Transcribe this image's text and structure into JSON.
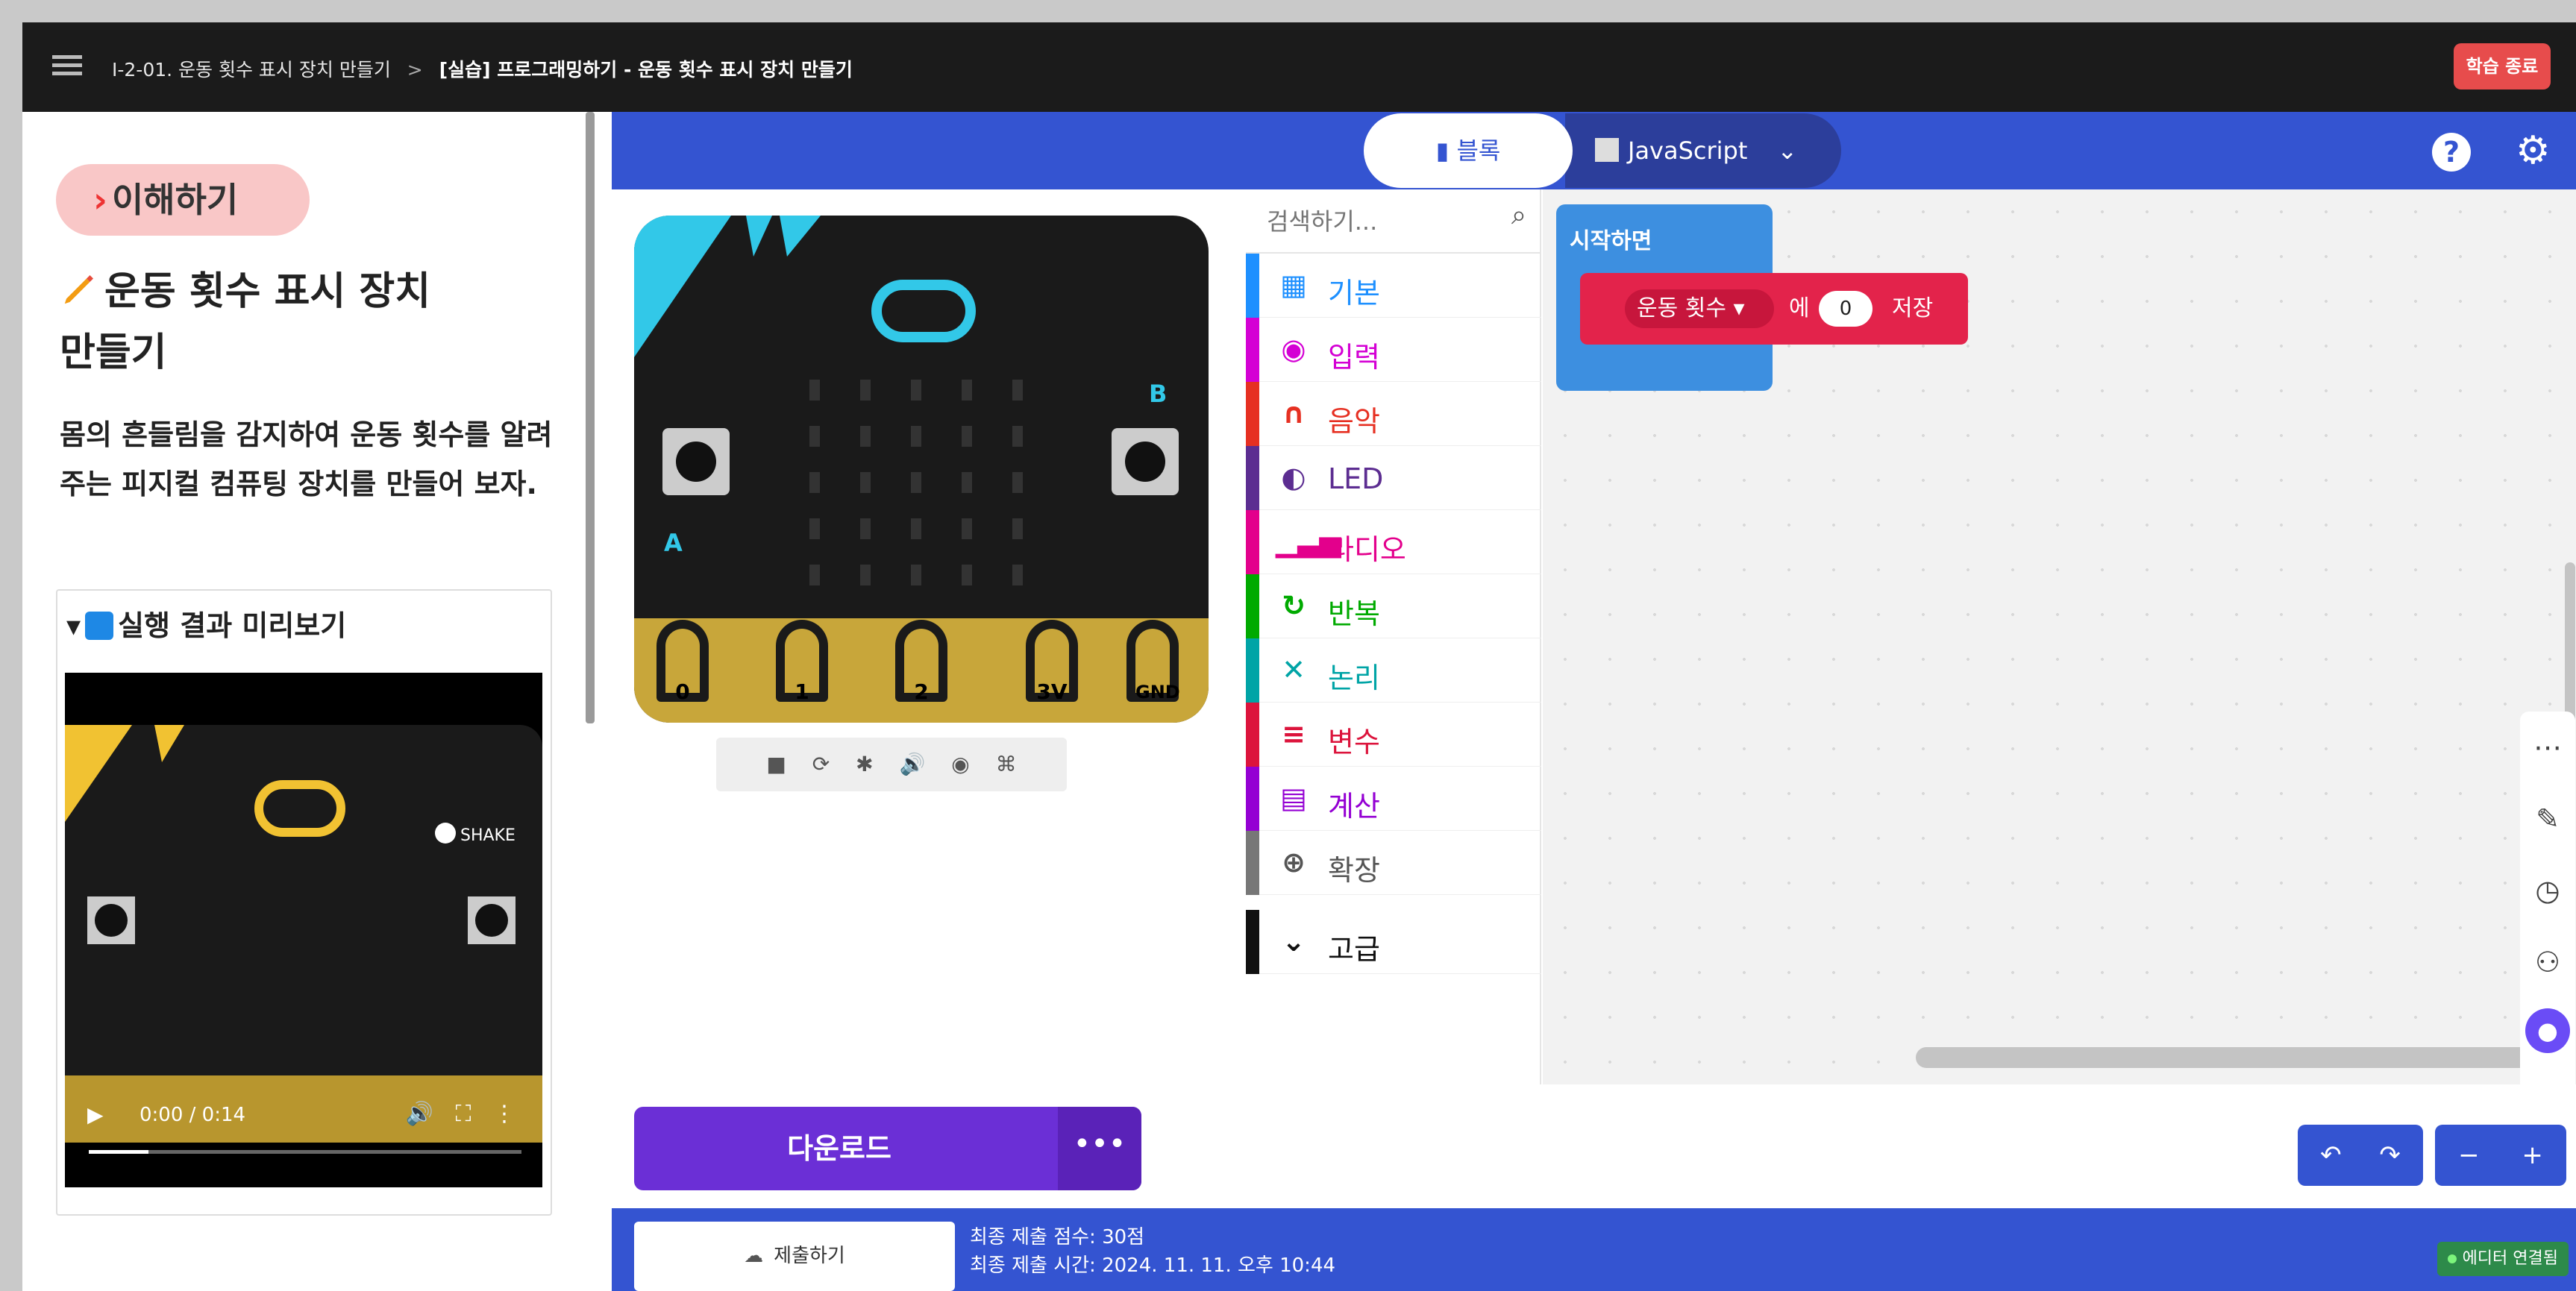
{
  "topbar": {
    "breadcrumb_1": "I-2-01. 운동 횟수 표시 장치 만들기",
    "breadcrumb_sep": ">",
    "breadcrumb_2": "[실습] 프로그래밍하기 - 운동 횟수 표시 장치 만들기",
    "end_button": "학습 종료"
  },
  "left": {
    "section_pill": "이해하기",
    "title": "운동 횟수 표시 장치 만들기",
    "description": "몸의 흔들림을 감지하여 운동 횟수를 알려 주는 피지컬 컴퓨팅 장치를 만들어 보자.",
    "preview_title": "실행 결과 미리보기",
    "video": {
      "time": "0:00 / 0:14",
      "progress": 0,
      "shake_label": "SHAKE"
    }
  },
  "editor": {
    "tab_blocks": "블록",
    "tab_js": "JavaScript",
    "pins": [
      "0",
      "1",
      "2",
      "3V",
      "GND"
    ],
    "button_a": "A",
    "button_b": "B",
    "search_placeholder": "검색하기...",
    "categories": [
      {
        "label": "기본",
        "color": "#1e90ff",
        "icon": "grid-icon"
      },
      {
        "label": "입력",
        "color": "#d400d4",
        "icon": "circle-dot-icon"
      },
      {
        "label": "음악",
        "color": "#e63022",
        "icon": "headphones-icon"
      },
      {
        "label": "LED",
        "color": "#5c2d91",
        "icon": "toggle-icon"
      },
      {
        "label": "라디오",
        "color": "#e3008c",
        "icon": "signal-icon"
      },
      {
        "label": "반복",
        "color": "#00aa00",
        "icon": "refresh-icon"
      },
      {
        "label": "논리",
        "color": "#00a4a6",
        "icon": "shuffle-icon"
      },
      {
        "label": "변수",
        "color": "#dc143c",
        "icon": "list-icon"
      },
      {
        "label": "계산",
        "color": "#9400d3",
        "icon": "calculator-icon"
      },
      {
        "label": "확장",
        "color": "#777777",
        "icon": "plus-circle-icon"
      },
      {
        "label": "고급",
        "color": "#111111",
        "icon": "chevron-down-icon"
      }
    ],
    "on_start": "시작하면",
    "set_block": {
      "variable": "운동 횟수 ▾",
      "particle": "에",
      "value": "0",
      "action": "저장"
    },
    "download": "다운로드"
  },
  "footer": {
    "submit": "제출하기",
    "score_line": "최종 제출 점수: 30점",
    "time_line": "최종 제출 시간: 2024. 11. 11. 오후 10:44",
    "connection": "에디터 연결됨"
  }
}
